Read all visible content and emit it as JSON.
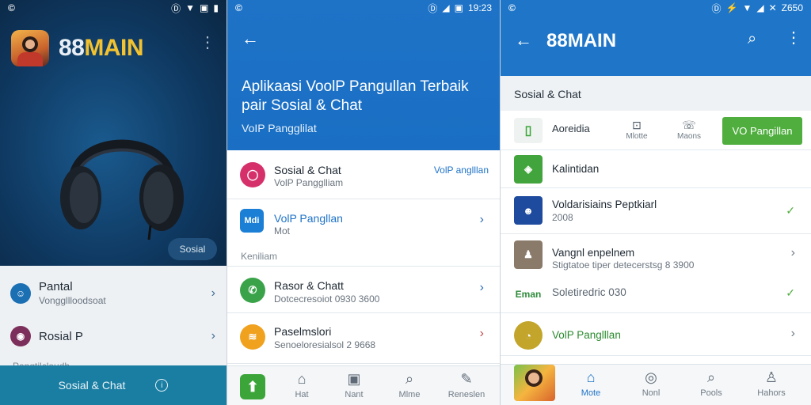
{
  "panel1": {
    "status_left": "©",
    "status_right": [
      "Ⓓ",
      "▼",
      "▣",
      "▮"
    ],
    "brand_part1": "88",
    "brand_part2": "MAIN",
    "sosial_pill": "Sosial",
    "items": [
      {
        "title": "Pantal",
        "subtitle": "Vonggllloodsoat",
        "icon_color": "#1b6fb3"
      },
      {
        "title": "Rosial P",
        "subtitle": "",
        "icon_color": "#7b2f5a"
      }
    ],
    "partial_text": "Pangtilcloudh",
    "bottom_label": "Sosial & Chat"
  },
  "panel2": {
    "status_left": "©",
    "status_right": [
      "Ⓓ",
      "◢",
      "▣",
      "19:23"
    ],
    "title": "Aplikaasi VoolP Pangullan Terbaik pair Sosial & Chat",
    "subtitle": "VoIP Pangglilat",
    "rows": [
      {
        "title": "Sosial & Chat",
        "subtitle": "VolP Pangglliam",
        "right_text": "VolP anglllan",
        "icon_color": "#d6306a"
      },
      {
        "title": "VolP Pangllan",
        "subtitle": "Mot",
        "icon_color": "#1b7fd6",
        "icon_text": "Mdi"
      },
      {
        "title": "Rasor & Chatt",
        "subtitle": "Dotcecresoiot 0930 3600",
        "icon_color": "#3aa34a"
      },
      {
        "title": "Paselmslori",
        "subtitle": "Senoeloresialsol 2 9668",
        "icon_color": "#f0a21f"
      }
    ],
    "section_label": "Keniliam",
    "nav": [
      {
        "label": "Hat",
        "icon": "home-icon"
      },
      {
        "label": "Nant",
        "icon": "chat-icon"
      },
      {
        "label": "Mlme",
        "icon": "search-icon"
      },
      {
        "label": "Reneslen",
        "icon": "edit-icon"
      }
    ]
  },
  "panel3": {
    "status_left": "©",
    "status_right": [
      "Ⓓ",
      "⚡",
      "▼",
      "◢",
      "✕",
      "Z650"
    ],
    "brand": "88MAIN",
    "section_label": "Sosial & Chat",
    "actions": {
      "app_label": "Aoreidia",
      "mini1": "Mlotte",
      "mini2": "Maons",
      "cta": "VO Pangillan"
    },
    "rows": [
      {
        "title": "Kalintidan",
        "subtitle": "",
        "icon_color": "#42a43c",
        "trail": "none"
      },
      {
        "title": "Voldarisiains Peptkiarl",
        "subtitle": "2008",
        "icon_color": "#1e4b9e",
        "trail": "check"
      },
      {
        "title": "Vangnl enpelnem",
        "subtitle": "Stigtatoe tiper detecerstsg 8 3900",
        "icon_color": "#8a7a6a",
        "trail": "chevron"
      },
      {
        "title": "Soletiredric 030",
        "subtitle": "",
        "icon_color": "#2f8b3b",
        "trail": "check",
        "icon_text": "Eman"
      },
      {
        "title": "VolP Panglllan",
        "subtitle": "",
        "icon_color": "#c2a52a",
        "trail": "chevron",
        "title_color": "#2a8a2f"
      }
    ],
    "nav": [
      {
        "label": "Mote",
        "icon": "home-icon"
      },
      {
        "label": "Nonl",
        "icon": "chat-icon"
      },
      {
        "label": "Pools",
        "icon": "search-icon"
      },
      {
        "label": "Hahors",
        "icon": "user-icon"
      }
    ]
  }
}
